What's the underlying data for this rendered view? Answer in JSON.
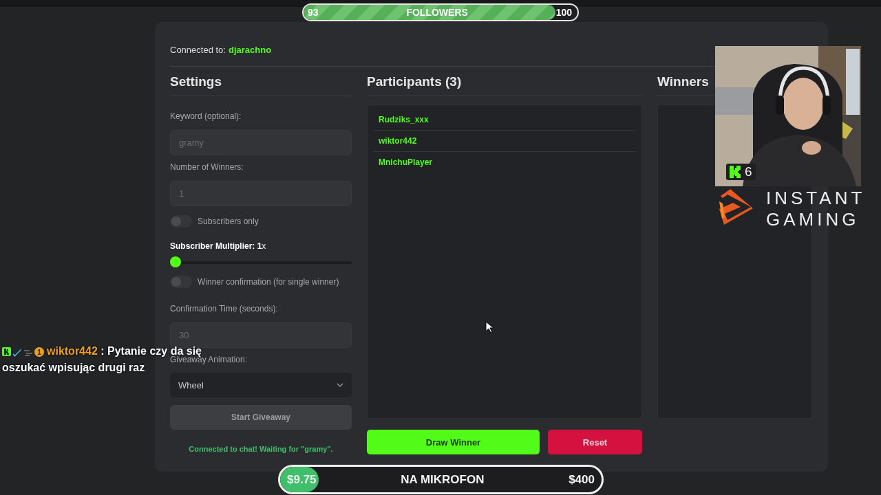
{
  "follower_goal": {
    "current": "93",
    "label": "FOLLOWERS",
    "target": "100",
    "level": 0.92
  },
  "connection": {
    "label": "Connected to:",
    "channel": "djarachno"
  },
  "settings": {
    "title": "Settings",
    "fields": [
      {
        "kind": "input",
        "label": "Keyword (optional):",
        "placeholder": "gramy"
      },
      {
        "kind": "input",
        "label": "Number of Winners:",
        "placeholder": "1"
      },
      {
        "kind": "toggle",
        "label": "Subscribers only",
        "on": false
      },
      {
        "kind": "slider",
        "label": "**Subscriber Multiplier: 1**x",
        "level": 0
      },
      {
        "kind": "toggle",
        "label": "Winner confirmation (for single winner)",
        "on": false
      },
      {
        "kind": "input",
        "label": "Confirmation Time (seconds):",
        "placeholder": "30"
      },
      {
        "kind": "select",
        "label": "Giveaway Animation:",
        "value": "Wheel"
      }
    ],
    "start_button": {
      "label": "Start Giveaway",
      "disabled": true
    },
    "status": "Connected to chat! Waiting for \"gramy\"."
  },
  "participants": {
    "title": "Participants (3)",
    "items": [
      "Rudziks_xxx",
      "wiktor442",
      "MnichuPlayer"
    ],
    "draw_button": "Draw Winner",
    "reset_button": "Reset"
  },
  "winners": {
    "title": "Winners"
  },
  "chat": {
    "badge_number": "1",
    "username": "wiktor442",
    "message_lines": [
      ": Pytanie czy da się",
      "oszukać wpisując drugi raz"
    ]
  },
  "webcam": {
    "kind": "picture",
    "viewers": "6"
  },
  "sponsor": {
    "lines": [
      "INSTANT",
      "GAMING"
    ]
  },
  "donation_goal": {
    "current": "$9.75",
    "label": "NA MIKROFON",
    "target": "$400",
    "level": 0.12
  }
}
